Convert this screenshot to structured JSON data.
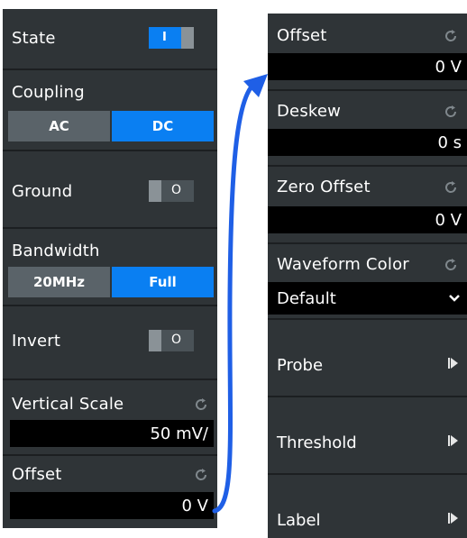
{
  "left": {
    "state": {
      "label": "State",
      "toggle": "I"
    },
    "coupling": {
      "label": "Coupling",
      "options": [
        "AC",
        "DC"
      ],
      "selected": "DC"
    },
    "ground": {
      "label": "Ground",
      "toggle": "O"
    },
    "bandwidth": {
      "label": "Bandwidth",
      "options": [
        "20MHz",
        "Full"
      ],
      "selected": "Full"
    },
    "invert": {
      "label": "Invert",
      "toggle": "O"
    },
    "vertical_scale": {
      "label": "Vertical Scale",
      "value": "50 mV/"
    },
    "offset": {
      "label": "Offset",
      "value": "0 V"
    }
  },
  "right": {
    "offset": {
      "label": "Offset",
      "value": "0 V"
    },
    "deskew": {
      "label": "Deskew",
      "value": "0 s"
    },
    "zero_offset": {
      "label": "Zero Offset",
      "value": "0 V"
    },
    "waveform_color": {
      "label": "Waveform Color",
      "value": "Default"
    },
    "probe": {
      "label": "Probe"
    },
    "threshold": {
      "label": "Threshold"
    },
    "label": {
      "label": "Label"
    }
  },
  "colors": {
    "accent": "#0a7ff2",
    "panel": "#2f3437",
    "field": "#000000",
    "arrow": "#1f5fe6"
  },
  "icons": [
    "reset-icon",
    "chevron-down-icon",
    "submenu-arrow-icon"
  ]
}
